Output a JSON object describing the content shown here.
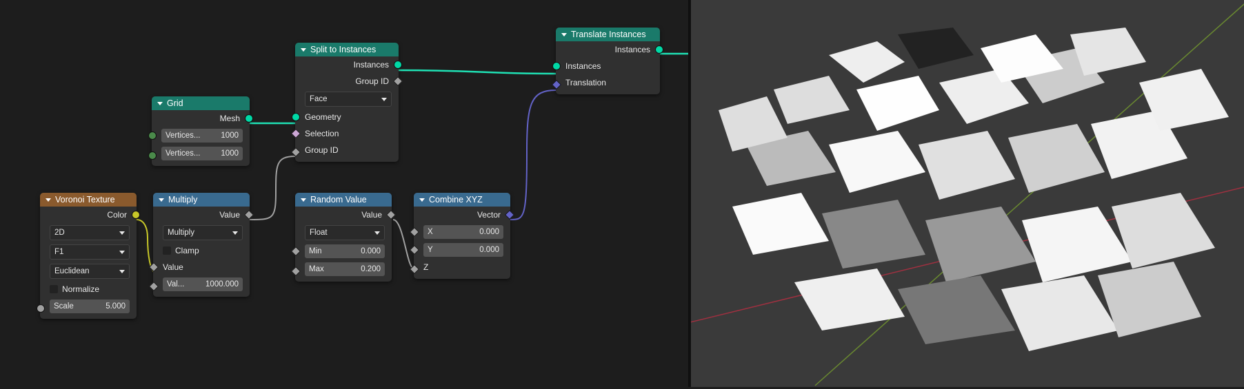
{
  "nodes": {
    "grid": {
      "title": "Grid",
      "outputs": {
        "mesh": "Mesh"
      },
      "fields": {
        "vx_label": "Vertices...",
        "vx_value": "1000",
        "vy_label": "Vertices...",
        "vy_value": "1000"
      }
    },
    "voronoi": {
      "title": "Voronoi Texture",
      "outputs": {
        "color": "Color"
      },
      "selects": {
        "dim": "2D",
        "type": "F1",
        "metric": "Euclidean"
      },
      "normalize_label": "Normalize",
      "scale_label": "Scale",
      "scale_value": "5.000"
    },
    "multiply": {
      "title": "Multiply",
      "outputs": {
        "value": "Value"
      },
      "op": "Multiply",
      "clamp_label": "Clamp",
      "inputs": {
        "value": "Value",
        "val_label": "Val...",
        "val_value": "1000.000"
      }
    },
    "split": {
      "title": "Split to Instances",
      "outputs": {
        "instances": "Instances",
        "groupid": "Group ID"
      },
      "select": "Face",
      "inputs": {
        "geometry": "Geometry",
        "selection": "Selection",
        "groupid": "Group ID"
      }
    },
    "random": {
      "title": "Random Value",
      "outputs": {
        "value": "Value"
      },
      "select": "Float",
      "min_label": "Min",
      "min_value": "0.000",
      "max_label": "Max",
      "max_value": "0.200"
    },
    "combine": {
      "title": "Combine XYZ",
      "outputs": {
        "vector": "Vector"
      },
      "x_label": "X",
      "x_value": "0.000",
      "y_label": "Y",
      "y_value": "0.000",
      "z_label": "Z"
    },
    "translate": {
      "title": "Translate Instances",
      "outputs": {
        "instances": "Instances"
      },
      "inputs": {
        "instances": "Instances",
        "translation": "Translation"
      }
    }
  }
}
